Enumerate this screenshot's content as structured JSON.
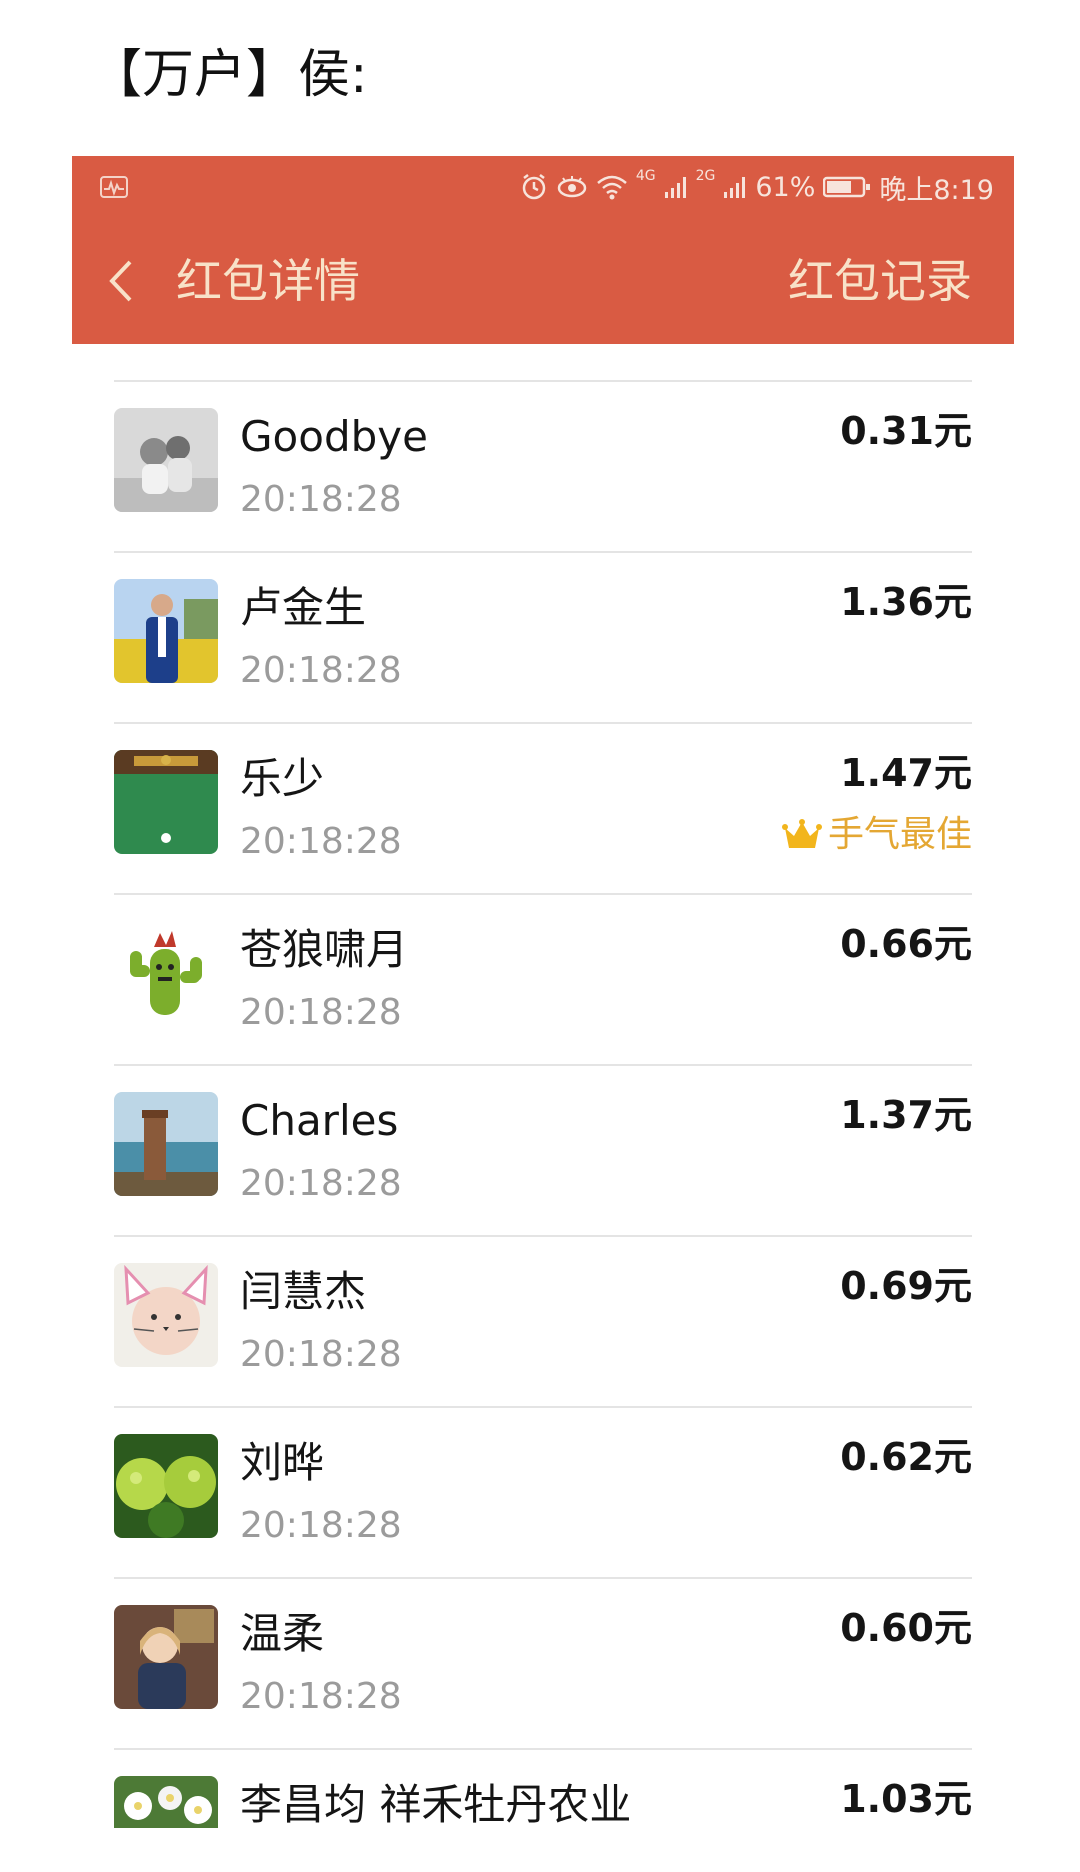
{
  "caption": "【万户】侯:",
  "status_bar": {
    "network_4g": "4G",
    "network_2g": "2G",
    "battery": "61%",
    "time": "晚上8:19"
  },
  "nav": {
    "title": "红包详情",
    "action": "红包记录"
  },
  "colors": {
    "header_bg": "#d95b43",
    "header_text": "#f8e2c8",
    "best_luck": "#e4a733"
  },
  "records": [
    {
      "name": "Goodbye",
      "time": "20:18:28",
      "amount": "0.31元",
      "avatar": "grayscale-children-photo"
    },
    {
      "name": "卢金生",
      "time": "20:18:28",
      "amount": "1.36元",
      "avatar": "man-in-rapeseed-field-photo"
    },
    {
      "name": "乐少",
      "time": "20:18:28",
      "amount": "1.47元",
      "avatar": "billiards-table-photo",
      "best_luck": "手气最佳"
    },
    {
      "name": "苍狼啸月",
      "time": "20:18:28",
      "amount": "0.66元",
      "avatar": "cactus-cartoon"
    },
    {
      "name": "Charles",
      "time": "20:18:28",
      "amount": "1.37元",
      "avatar": "sea-stack-photo"
    },
    {
      "name": "闫慧杰",
      "time": "20:18:28",
      "amount": "0.69元",
      "avatar": "baby-cat-filter-photo"
    },
    {
      "name": "刘晔",
      "time": "20:18:28",
      "amount": "0.62元",
      "avatar": "green-hydrangea-photo"
    },
    {
      "name": "温柔",
      "time": "20:18:28",
      "amount": "0.60元",
      "avatar": "woman-portrait-photo"
    },
    {
      "name": "李昌均  祥禾牡丹农业",
      "time": "",
      "amount": "1.03元",
      "avatar": "white-flowers-photo"
    }
  ]
}
